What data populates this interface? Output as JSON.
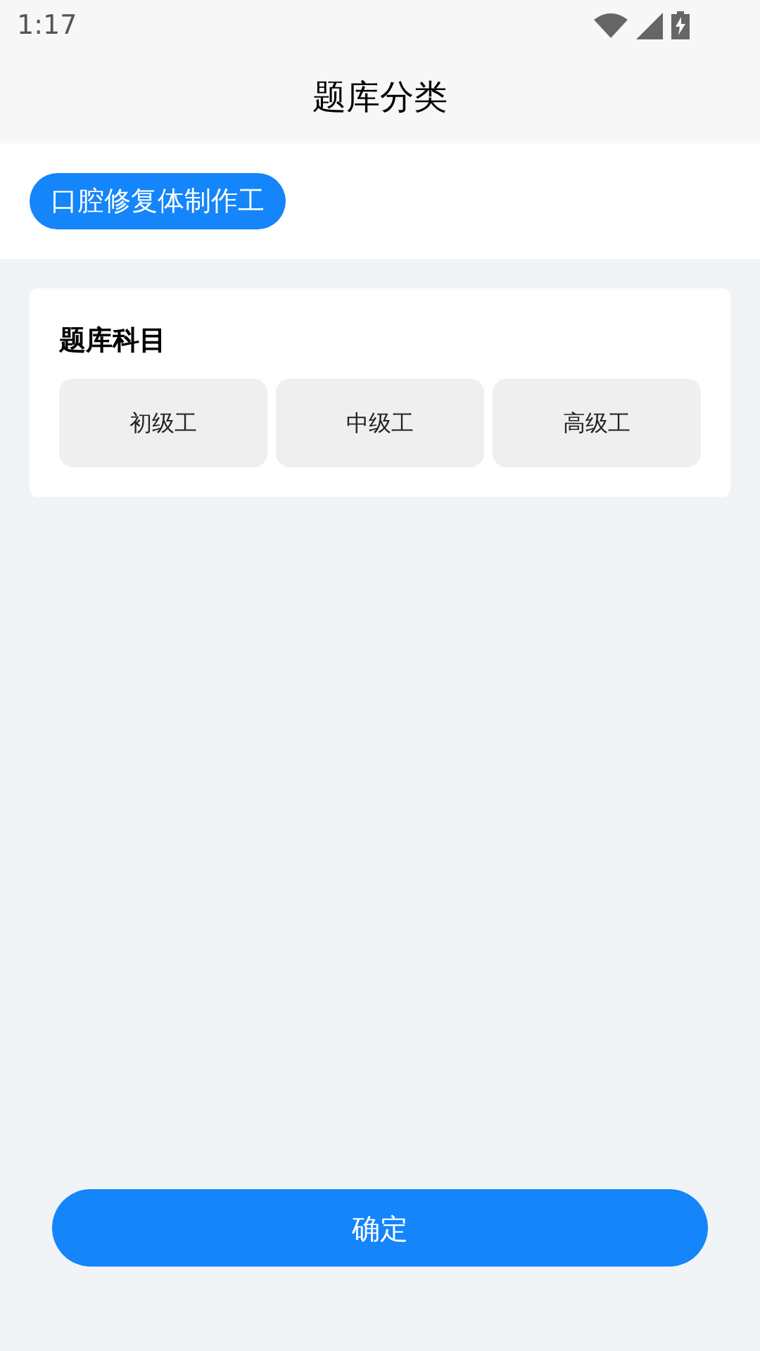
{
  "status_bar": {
    "time": "1:17"
  },
  "header": {
    "title": "题库分类"
  },
  "categories": [
    {
      "label": "口腔修复体制作工",
      "selected": true
    }
  ],
  "subjects": {
    "title": "题库科目",
    "items": [
      {
        "label": "初级工",
        "selected": false
      },
      {
        "label": "中级工",
        "selected": false
      },
      {
        "label": "高级工",
        "selected": false
      }
    ]
  },
  "confirm_button": {
    "label": "确定"
  }
}
